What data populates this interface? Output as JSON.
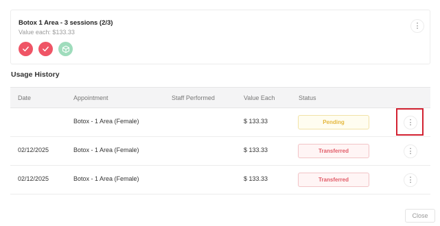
{
  "package": {
    "title": "Botox 1 Area - 3 sessions (2/3)",
    "value_label": "Value each: $133.33",
    "sessions": [
      "used",
      "used",
      "available"
    ],
    "menu_icon": "more-vertical-icon"
  },
  "usage_history": {
    "title": "Usage History",
    "columns": {
      "date": "Date",
      "appointment": "Appointment",
      "staff": "Staff Performed",
      "value": "Value Each",
      "status": "Status"
    },
    "rows": [
      {
        "date": "",
        "appointment": "Botox - 1 Area (Female)",
        "staff": "",
        "value": "$ 133.33",
        "status": "Pending"
      },
      {
        "date": "02/12/2025",
        "appointment": "Botox - 1 Area (Female)",
        "staff": "",
        "value": "$ 133.33",
        "status": "Transferred"
      },
      {
        "date": "02/12/2025",
        "appointment": "Botox - 1 Area (Female)",
        "staff": "",
        "value": "$ 133.33",
        "status": "Transferred"
      }
    ]
  },
  "footer": {
    "close_label": "Close"
  },
  "colors": {
    "used_session": "#ef5566",
    "available_session": "#9fdcbc",
    "pending": "#e4b73c",
    "transferred": "#e15b67",
    "highlight": "#d22030"
  }
}
